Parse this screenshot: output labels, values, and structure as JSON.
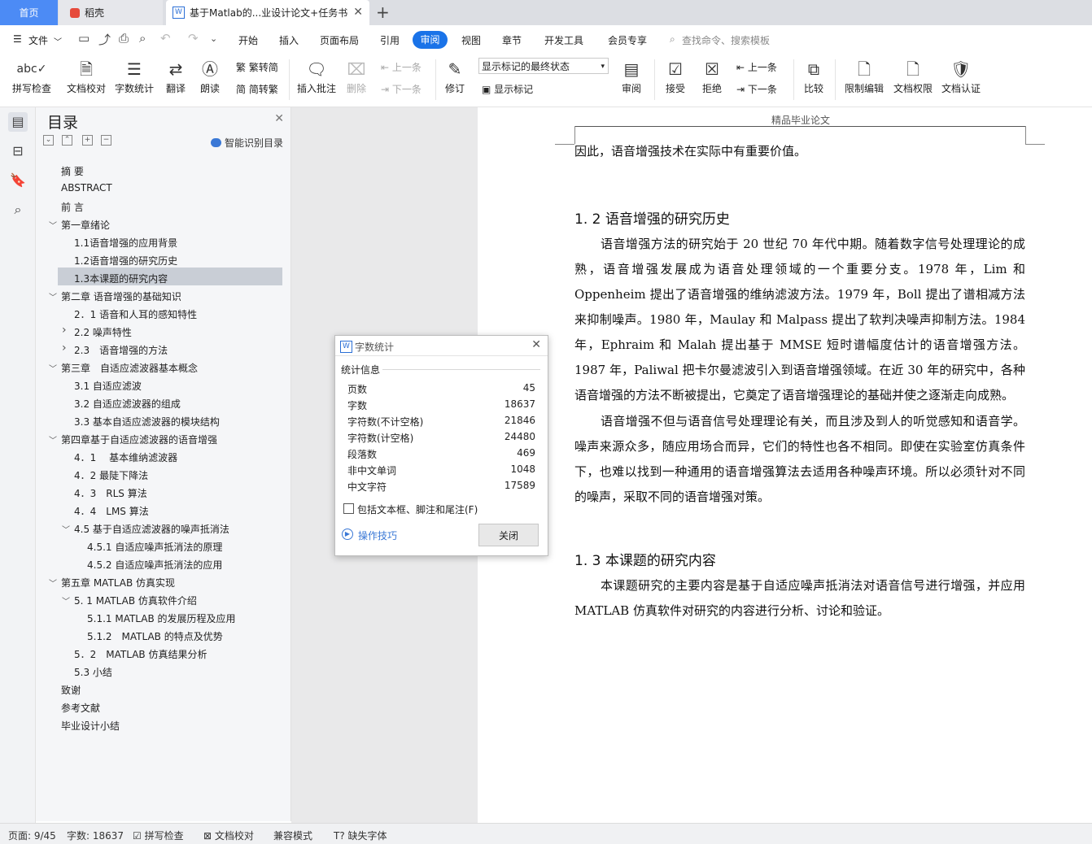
{
  "tabs": {
    "home": "首页",
    "daoke": "稻壳",
    "document": "基于Matlab的...业设计论文+任务书",
    "new_tab": "+"
  },
  "menu": {
    "file": "文件",
    "items": [
      "开始",
      "插入",
      "页面布局",
      "引用",
      "审阅",
      "视图",
      "章节",
      "开发工具",
      "会员专享"
    ],
    "search_placeholder": "查找命令、搜索模板"
  },
  "ribbon": {
    "spell_check": "拼写检查",
    "doc_proof": "文档校对",
    "word_count": "字数统计",
    "translate": "翻译",
    "read_aloud": "朗读",
    "to_traditional": "繁转简",
    "to_simplified": "简转繁",
    "insert_comment": "插入批注",
    "delete": "删除",
    "prev": "上一条",
    "next": "下一条",
    "track_changes": "修订",
    "markup_state": "显示标记的最终状态",
    "show_markup": "显示标记",
    "review": "审阅",
    "accept": "接受",
    "reject": "拒绝",
    "prev2": "上一条",
    "next2": "下一条",
    "compare": "比较",
    "restrict_edit": "限制编辑",
    "doc_permission": "文档权限",
    "doc_cert": "文档认证"
  },
  "toc": {
    "title": "目录",
    "smart": "智能识别目录",
    "items": [
      "摘 要",
      "ABSTRACT",
      "前 言",
      "第一章绪论",
      "1.1语音增强的应用背景",
      "1.2语音增强的研究历史",
      "1.3本课题的研究内容",
      "第二章 语音增强的基础知识",
      "2．1 语音和人耳的感知特性",
      "2.2 噪声特性",
      "2.3　语音增强的方法",
      "第三章　自适应滤波器基本概念",
      "3.1 自适应滤波",
      "3.2 自适应滤波器的组成",
      "3.3 基本自适应滤波器的模块结构",
      "第四章基于自适应滤波器的语音增强",
      "4．1　 基本维纳滤波器",
      "4．2 最陡下降法",
      "4．3　RLS 算法",
      "4．4　LMS 算法",
      "4.5  基于自适应滤波器的噪声抵消法",
      "4.5.1 自适应噪声抵消法的原理",
      "4.5.2 自适应噪声抵消法的应用",
      "第五章 MATLAB 仿真实现",
      "5. 1 MATLAB 仿真软件介绍",
      "5.1.1 MATLAB 的发展历程及应用",
      "5.1.2　MATLAB 的特点及优势",
      "5．2　MATLAB 仿真结果分析",
      "5.3 小结",
      "致谢",
      "参考文献",
      "毕业设计小结"
    ]
  },
  "document": {
    "header": "精品毕业论文",
    "line0": "因此，语音增强技术在实际中有重要价值。",
    "h12": "1. 2  语音增强的研究历史",
    "p1": "语音增强方法的研究始于 20 世纪 70 年代中期。随着数字信号处理理论的成熟，语音增强发展成为语音处理领域的一个重要分支。1978 年，Lim 和 Oppenheim 提出了语音增强的维纳滤波方法。1979 年，Boll 提出了谱相减方法来抑制噪声。1980 年，Maulay 和 Malpass 提出了软判决噪声抑制方法。1984 年，Ephraim 和 Malah 提出基于 MMSE 短时谱幅度估计的语音增强方法。1987 年，Paliwal 把卡尔曼滤波引入到语音增强领域。在近 30 年的研究中，各种语音增强的方法不断被提出，它奠定了语音增强理论的基础并使之逐渐走向成熟。",
    "p2": "语音增强不但与语音信号处理理论有关，而且涉及到人的听觉感知和语音学。噪声来源众多，随应用场合而异，它们的特性也各不相同。即使在实验室仿真条件下，也难以找到一种通用的语音增强算法去适用各种噪声环境。所以必须针对不同的噪声，采取不同的语音增强对策。",
    "h13": "1. 3  本课题的研究内容",
    "p3": "本课题研究的主要内容是基于自适应噪声抵消法对语音信号进行增强，并应用 MATLAB 仿真软件对研究的内容进行分析、讨论和验证。"
  },
  "dialog": {
    "title": "字数统计",
    "group": "统计信息",
    "stats": [
      {
        "label": "页数",
        "value": "45"
      },
      {
        "label": "字数",
        "value": "18637"
      },
      {
        "label": "字符数(不计空格)",
        "value": "21846"
      },
      {
        "label": "字符数(计空格)",
        "value": "24480"
      },
      {
        "label": "段落数",
        "value": "469"
      },
      {
        "label": "非中文单词",
        "value": "1048"
      },
      {
        "label": "中文字符",
        "value": "17589"
      }
    ],
    "checkbox": "包括文本框、脚注和尾注(F)",
    "tips": "操作技巧",
    "close": "关闭"
  },
  "status": {
    "page": "页面: 9/45",
    "words": "字数: 18637",
    "spell": "拼写检查",
    "proof": "文档校对",
    "compat": "兼容模式",
    "missing_font": "缺失字体"
  },
  "colors": {
    "accent": "#1a73e8",
    "home_tab": "#4c8bf5",
    "toc_selected": "#c9ced6"
  }
}
